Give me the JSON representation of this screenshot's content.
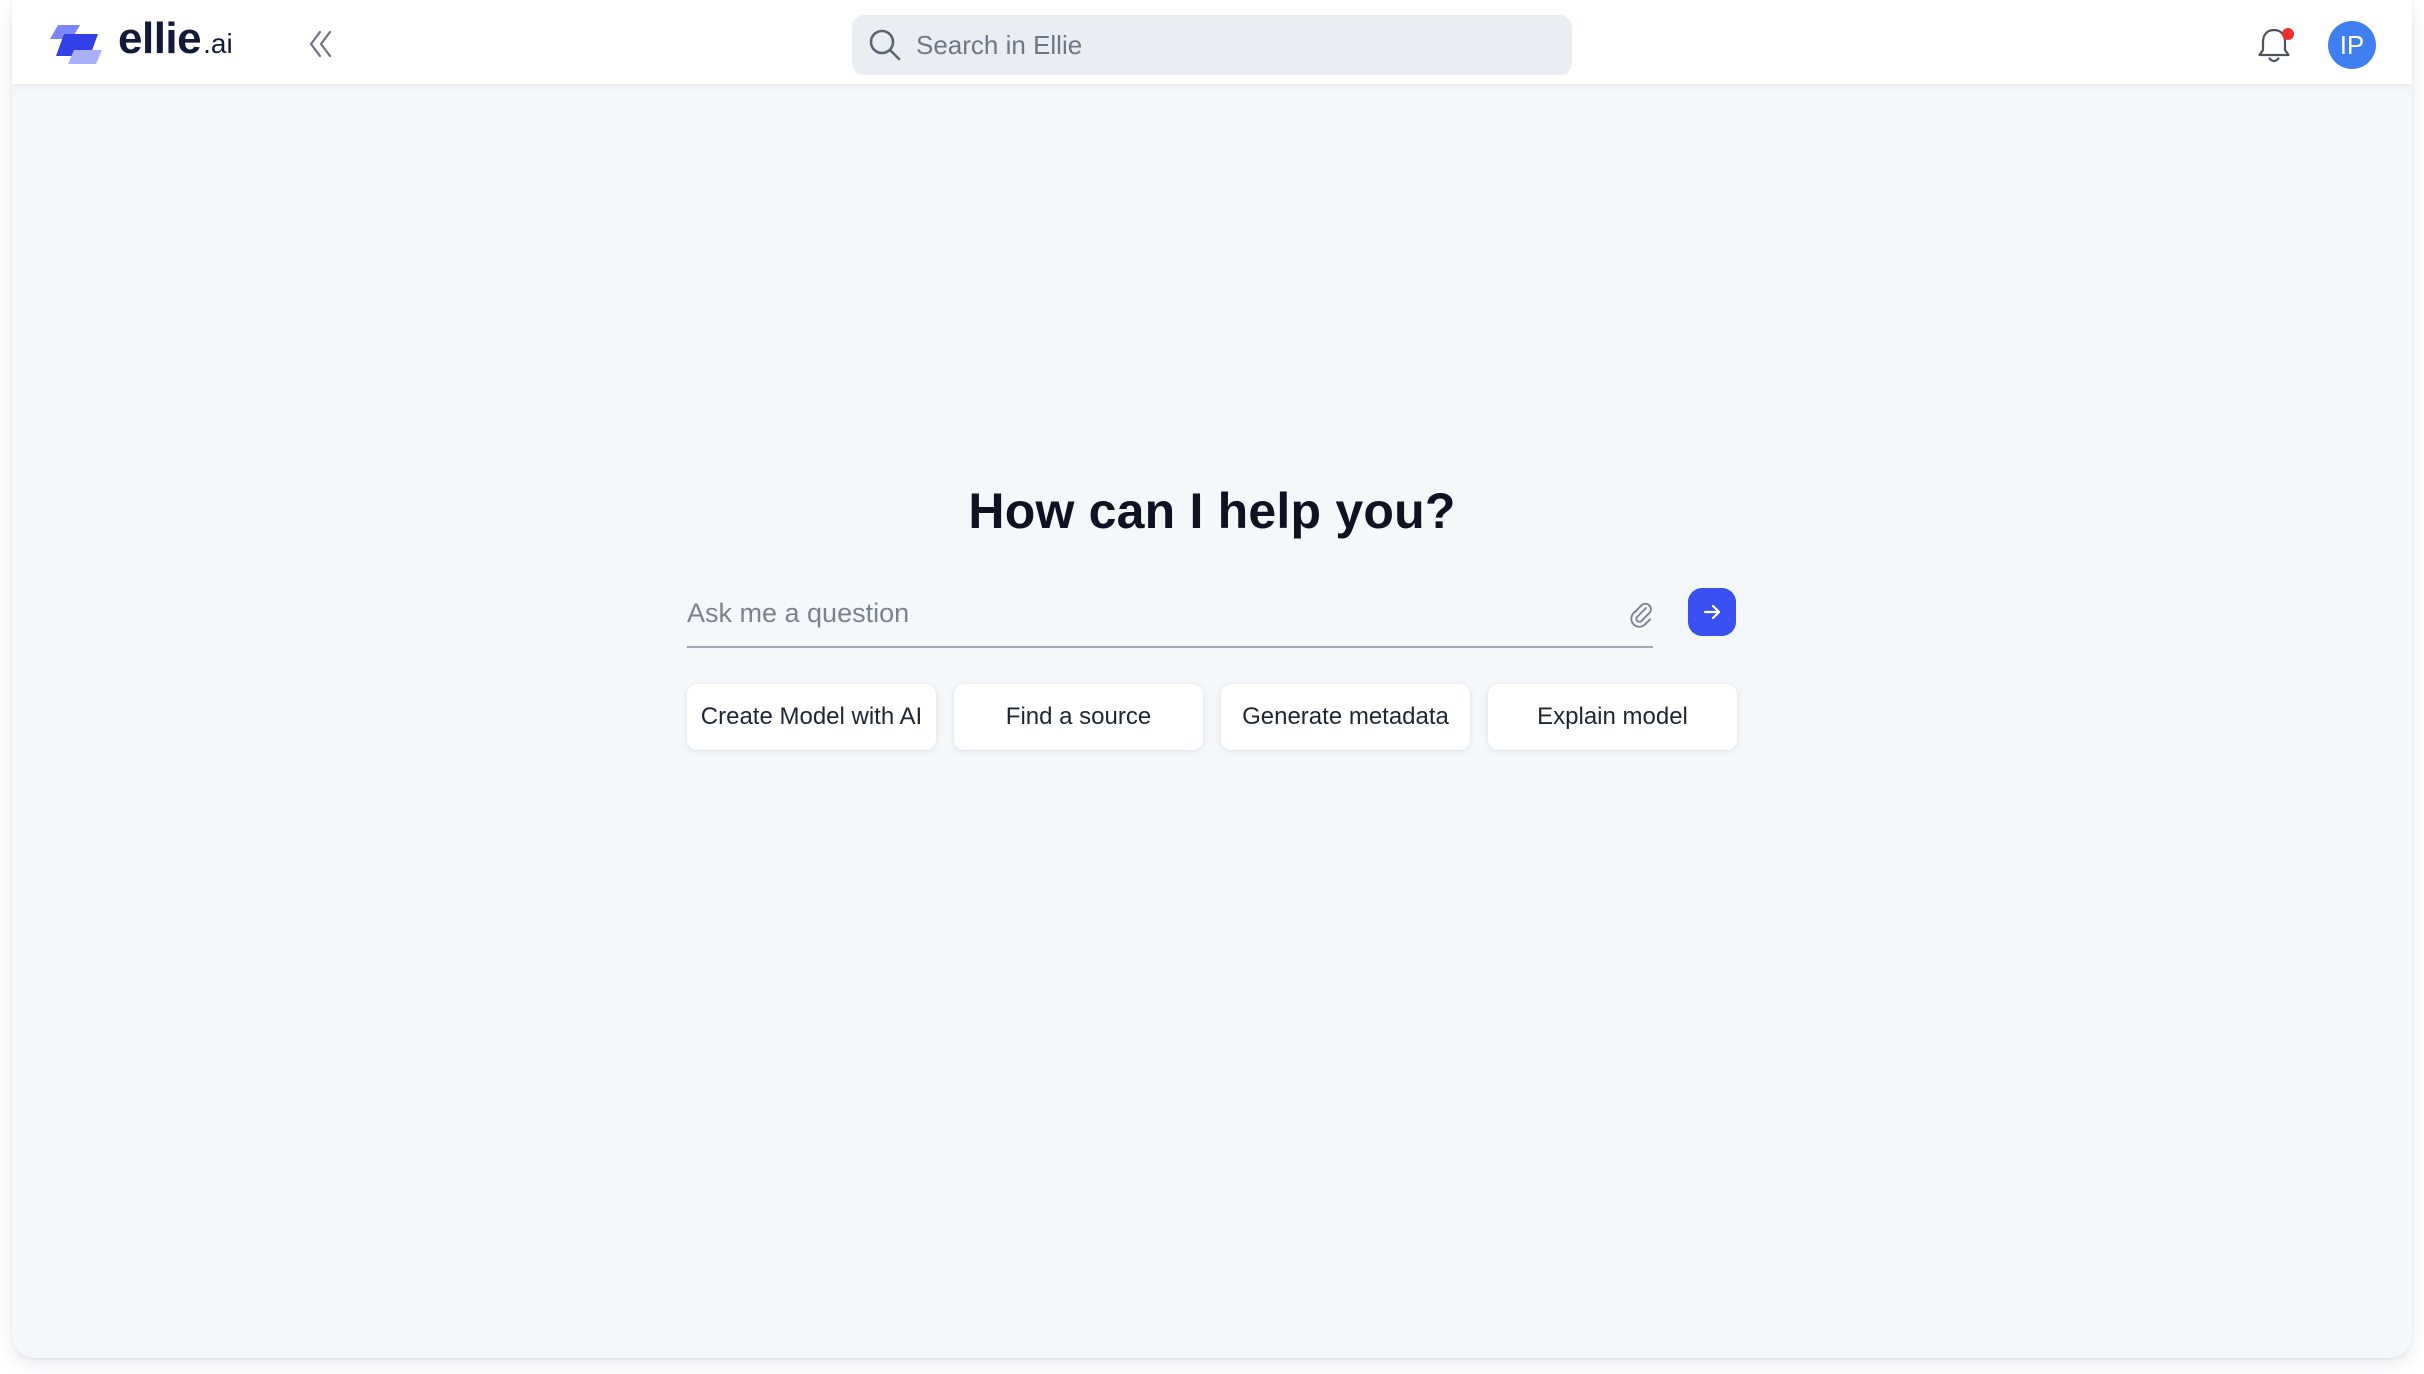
{
  "brand": {
    "name": "ellie",
    "suffix": ".ai"
  },
  "search": {
    "placeholder": "Search in Ellie",
    "value": ""
  },
  "user": {
    "initials": "IP",
    "avatar_color": "#3f7ff2"
  },
  "notifications": {
    "has_unread": true,
    "dot_color": "#ee2e2e"
  },
  "main": {
    "headline": "How can I help you?",
    "ask": {
      "placeholder": "Ask me a question",
      "value": ""
    },
    "suggestions": [
      {
        "label": "Create Model with AI"
      },
      {
        "label": "Find a source"
      },
      {
        "label": "Generate metadata"
      },
      {
        "label": "Explain model"
      }
    ]
  },
  "icons": {
    "logo": "ellie-logo-icon",
    "collapse": "double-chevron-left-icon",
    "search": "search-icon",
    "bell": "bell-icon",
    "attach": "paperclip-icon",
    "send": "arrow-right-icon"
  },
  "colors": {
    "accent": "#3b50f3",
    "background": "#f5f8fb"
  }
}
